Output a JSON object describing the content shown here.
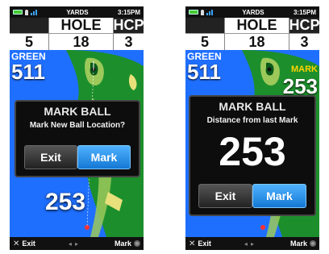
{
  "screens": [
    {
      "status": {
        "yards_label": "YARDS",
        "time": "3:15PM"
      },
      "header": {
        "hole_label": "HOLE",
        "hcp_label": "HCP",
        "par": "5",
        "hole": "18",
        "hcp": "3"
      },
      "map": {
        "green_label": "GREEN",
        "green_dist": "511",
        "mark_label": "",
        "mark_dist": "",
        "shot_dist": "253"
      },
      "dialog": {
        "title": "MARK BALL",
        "message": "Mark New Ball Location?",
        "big_value": "",
        "exit_label": "Exit",
        "mark_label": "Mark"
      },
      "bottom": {
        "exit_label": "Exit",
        "mark_label": "Mark"
      }
    },
    {
      "status": {
        "yards_label": "YARDS",
        "time": "3:15PM"
      },
      "header": {
        "hole_label": "HOLE",
        "hcp_label": "HCP",
        "par": "5",
        "hole": "18",
        "hcp": "3"
      },
      "map": {
        "green_label": "GREEN",
        "green_dist": "511",
        "mark_label": "MARK",
        "mark_dist": "253",
        "shot_dist": ""
      },
      "dialog": {
        "title": "MARK BALL",
        "message": "Distance from last Mark",
        "big_value": "253",
        "exit_label": "Exit",
        "mark_label": "Mark"
      },
      "bottom": {
        "exit_label": "Exit",
        "mark_label": "Mark"
      }
    }
  ],
  "colors": {
    "water": "#1f6fff",
    "fairway": "#1c8f2c",
    "rough": "#9cc95a",
    "bunker": "#e8e07a",
    "mark_button": "#1478d4"
  }
}
